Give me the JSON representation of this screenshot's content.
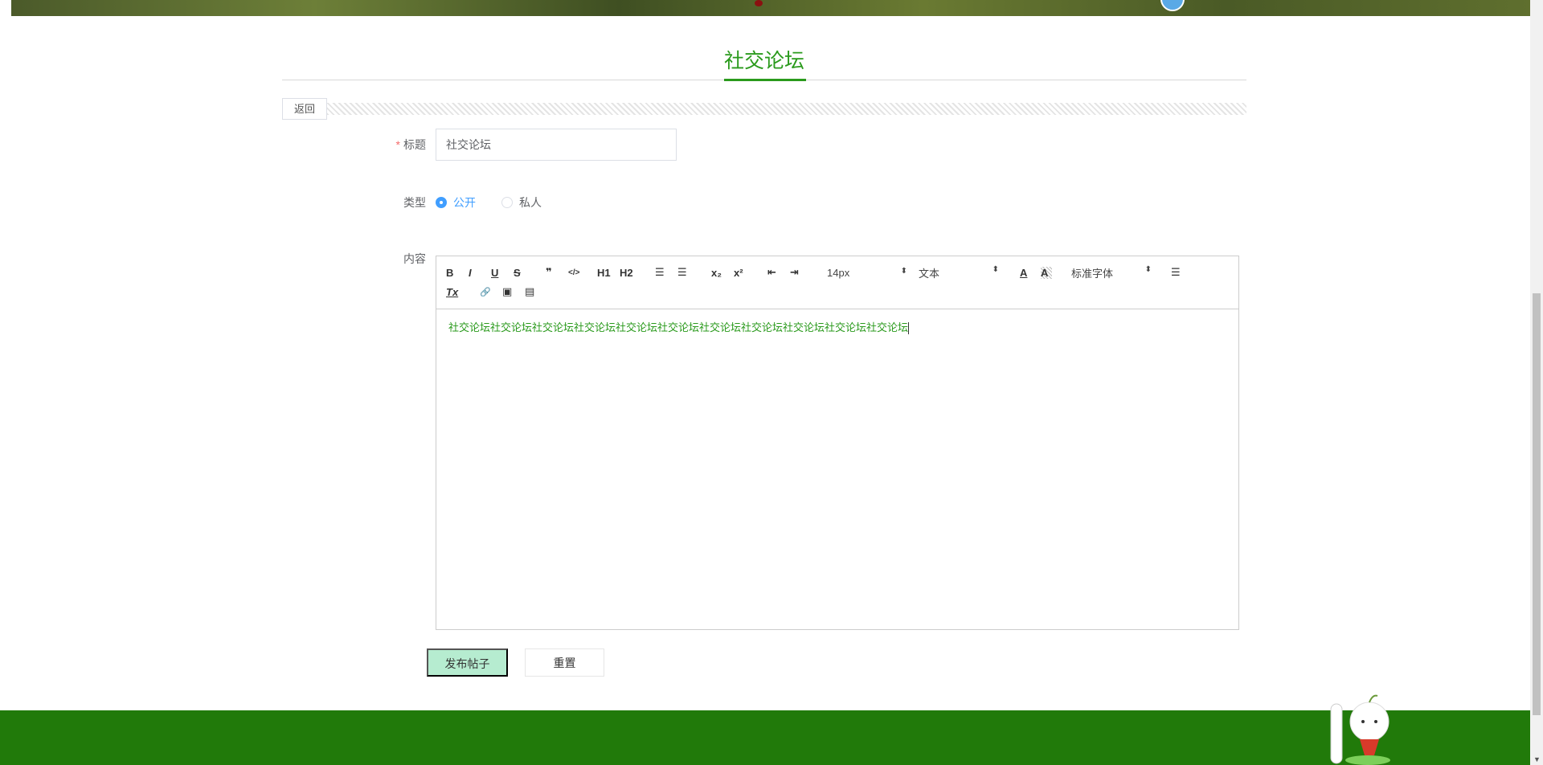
{
  "page": {
    "title": "社交论坛",
    "back_label": "返回"
  },
  "form": {
    "title_label": "标题",
    "title_required_mark": "*",
    "title_value": "社交论坛",
    "type_label": "类型",
    "type_options": [
      {
        "label": "公开",
        "selected": true
      },
      {
        "label": "私人",
        "selected": false
      }
    ],
    "content_label": "内容",
    "content_value": "社交论坛社交论坛社交论坛社交论坛社交论坛社交论坛社交论坛社交论坛社交论坛社交论坛社交论坛",
    "submit_label": "发布帖子",
    "reset_label": "重置"
  },
  "toolbar": {
    "bold": "B",
    "italic": "I",
    "underline": "U",
    "strike": "S",
    "blockquote": "❞",
    "code": "</>",
    "h1": "H1",
    "h2": "H2",
    "ordered_list": "☰",
    "bullet_list": "☰",
    "sub": "x₂",
    "sup": "x²",
    "outdent": "⇤",
    "indent": "⇥",
    "size": "14px",
    "header": "文本",
    "color": "A",
    "background": "A",
    "font": "标准字体",
    "align": "☰",
    "clean": "Tx",
    "link": "🔗",
    "image": "▣",
    "video": "▤"
  },
  "colors": {
    "accent": "#2a9a1c",
    "footer": "#217a0a",
    "submit_bg": "#b6ecd0",
    "radio": "#409eff"
  }
}
